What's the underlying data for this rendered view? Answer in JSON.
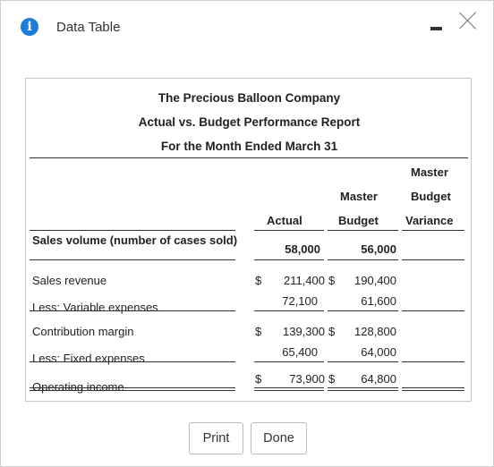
{
  "dialog": {
    "title": "Data Table"
  },
  "report": {
    "company": "The Precious Balloon Company",
    "title": "Actual vs. Budget Performance Report",
    "period": "For the Month Ended March 31",
    "columns": {
      "actual": "Actual",
      "master_budget_line1": "Master",
      "master_budget_line2": "Budget",
      "variance_line1": "Master",
      "variance_line2": "Budget",
      "variance_line3": "Variance"
    },
    "rows": {
      "sales_volume": {
        "label": "Sales volume (number of cases sold)",
        "actual": "58,000",
        "budget": "56,000"
      },
      "sales_revenue": {
        "label": "Sales revenue",
        "actual_cur": "$",
        "actual": "211,400",
        "budget_cur": "$",
        "budget": "190,400"
      },
      "variable_expenses": {
        "label": "Less: Variable expenses",
        "actual": "72,100",
        "budget": "61,600"
      },
      "contribution_margin": {
        "label": "Contribution margin",
        "actual_cur": "$",
        "actual": "139,300",
        "budget_cur": "$",
        "budget": "128,800"
      },
      "fixed_expenses": {
        "label": "Less: Fixed expenses",
        "actual": "65,400",
        "budget": "64,000"
      },
      "operating_income": {
        "label": "Operating income",
        "actual_cur": "$",
        "actual": "73,900",
        "budget_cur": "$",
        "budget": "64,800"
      }
    }
  },
  "buttons": {
    "print": "Print",
    "done": "Done"
  }
}
